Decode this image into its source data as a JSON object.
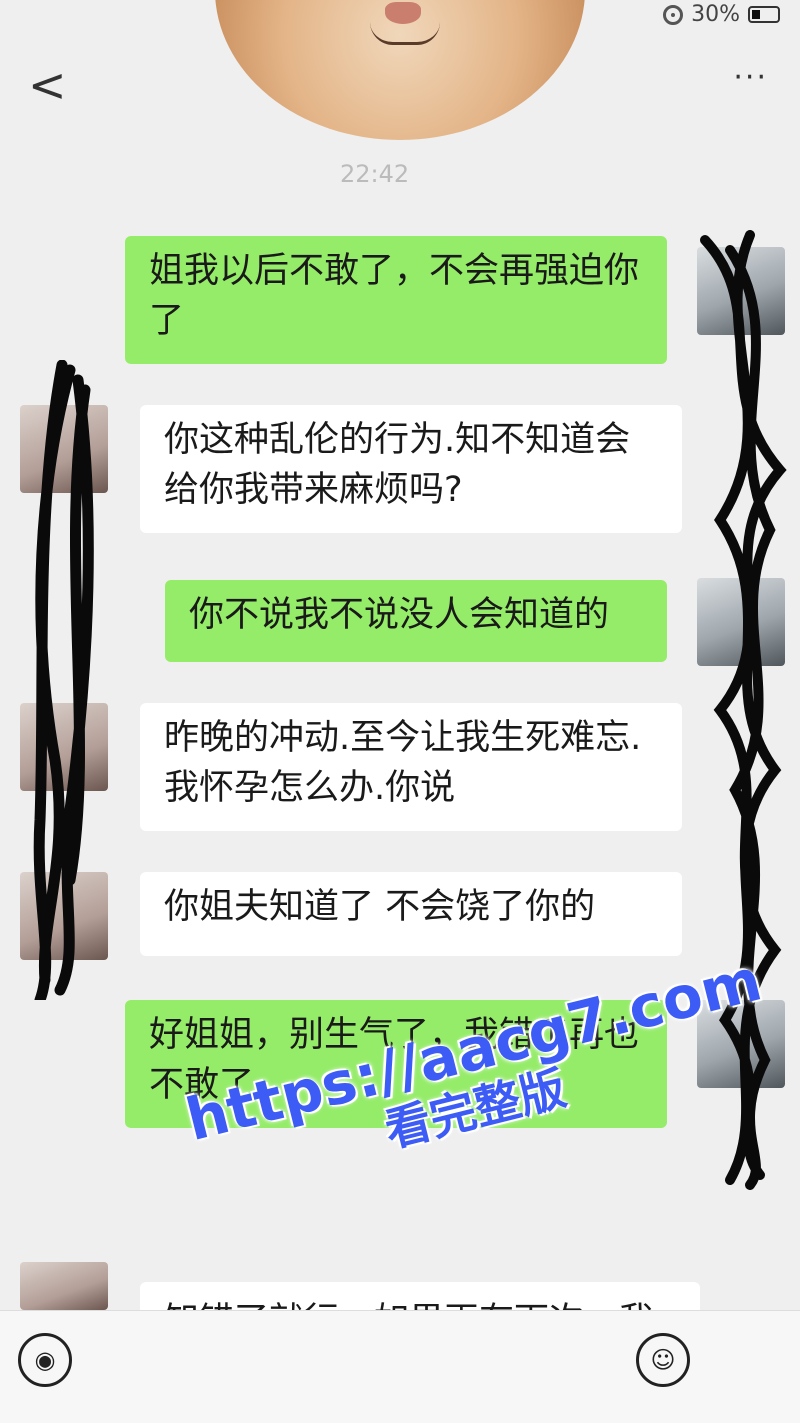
{
  "status": {
    "battery": "30%"
  },
  "header": {
    "back": "<",
    "more": "···"
  },
  "timestamp": "22:42",
  "messages": [
    {
      "side": "me",
      "text": "姐我以后不敢了，不会再强迫你了"
    },
    {
      "side": "them",
      "text": "你这种乱伦的行为.知不知道会给你我带来麻烦吗?"
    },
    {
      "side": "me",
      "text": "你不说我不说没人会知道的"
    },
    {
      "side": "them",
      "text": "昨晚的冲动.至今让我生死难忘.我怀孕怎么办.你说"
    },
    {
      "side": "them",
      "text": "你姐夫知道了 不会饶了你的"
    },
    {
      "side": "me",
      "text": "好姐姐，别生气了，我错了再也不敢了"
    },
    {
      "side": "them",
      "text": "知错了就行，如果再有下次，我有"
    }
  ],
  "watermark": {
    "url": "https://aacg7.com",
    "subtitle": "看完整版"
  },
  "input_bar": {
    "voice_icon": "voice-icon",
    "emoji_icon": "emoji-icon"
  }
}
